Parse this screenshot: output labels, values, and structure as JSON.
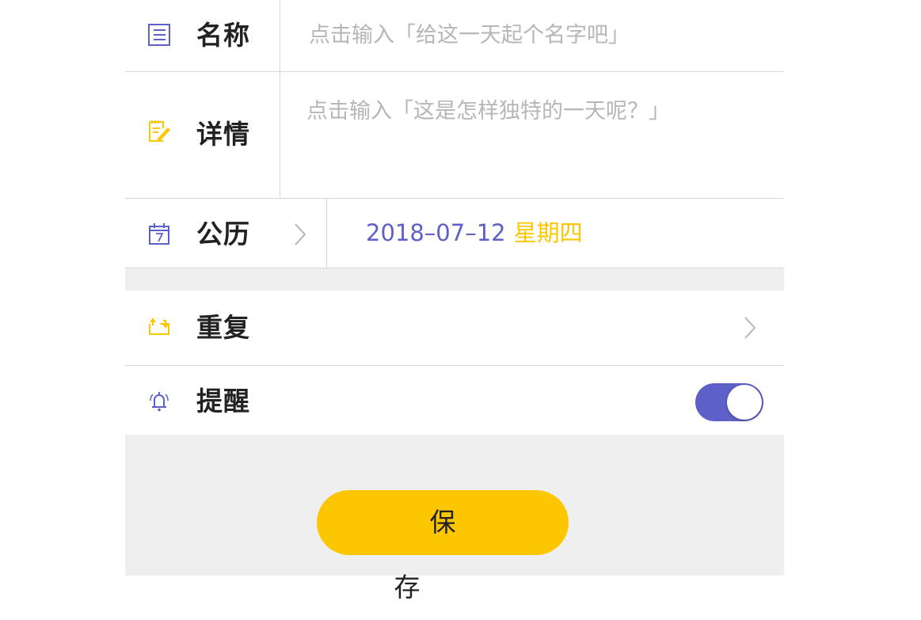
{
  "form": {
    "name": {
      "label": "名称",
      "placeholder": "点击输入「给这一天起个名字吧」",
      "icon": "list-icon"
    },
    "details": {
      "label": "详情",
      "placeholder": "点击输入「这是怎样独特的一天呢？」",
      "icon": "note-pencil-icon"
    },
    "calendar": {
      "label": "公历",
      "date": "2018–07–12",
      "weekday": "星期四",
      "icon": "calendar-7-icon"
    },
    "repeat": {
      "label": "重复",
      "icon": "repeat-icon"
    },
    "reminder": {
      "label": "提醒",
      "icon": "bell-icon",
      "enabled": true
    }
  },
  "save_button": {
    "label": "保存"
  },
  "colors": {
    "accent_purple": "#5d60c8",
    "accent_yellow": "#fcc600",
    "background": "#efefef"
  }
}
